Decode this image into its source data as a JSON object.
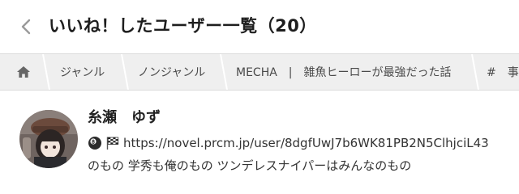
{
  "header": {
    "back_icon": "chevron-left-icon",
    "title": "いいね！したユーザー一覧（20）"
  },
  "tags": {
    "home_icon": "home-icon",
    "items": [
      {
        "label": "ジャンル"
      },
      {
        "label": "ノンジャンル"
      },
      {
        "label": "MECHA　|　雑魚ヒーローが最強だった話"
      },
      {
        "label": "#　事"
      }
    ]
  },
  "user": {
    "name": "糸瀬　ゆず",
    "icons": [
      "8-ball-icon",
      "checkered-flag-icon"
    ],
    "url": "https://novel.prcm.jp/user/8dgfUwJ7b6WK81PB2N5ClhjciL43",
    "bio": "のもの 学秀も俺のもの ツンデレスナイパーはみんなのもの"
  },
  "colors": {
    "tagbar_bg": "#efefef",
    "text": "#222222",
    "muted_text": "#4a4a4a",
    "icon_gray": "#666666"
  }
}
